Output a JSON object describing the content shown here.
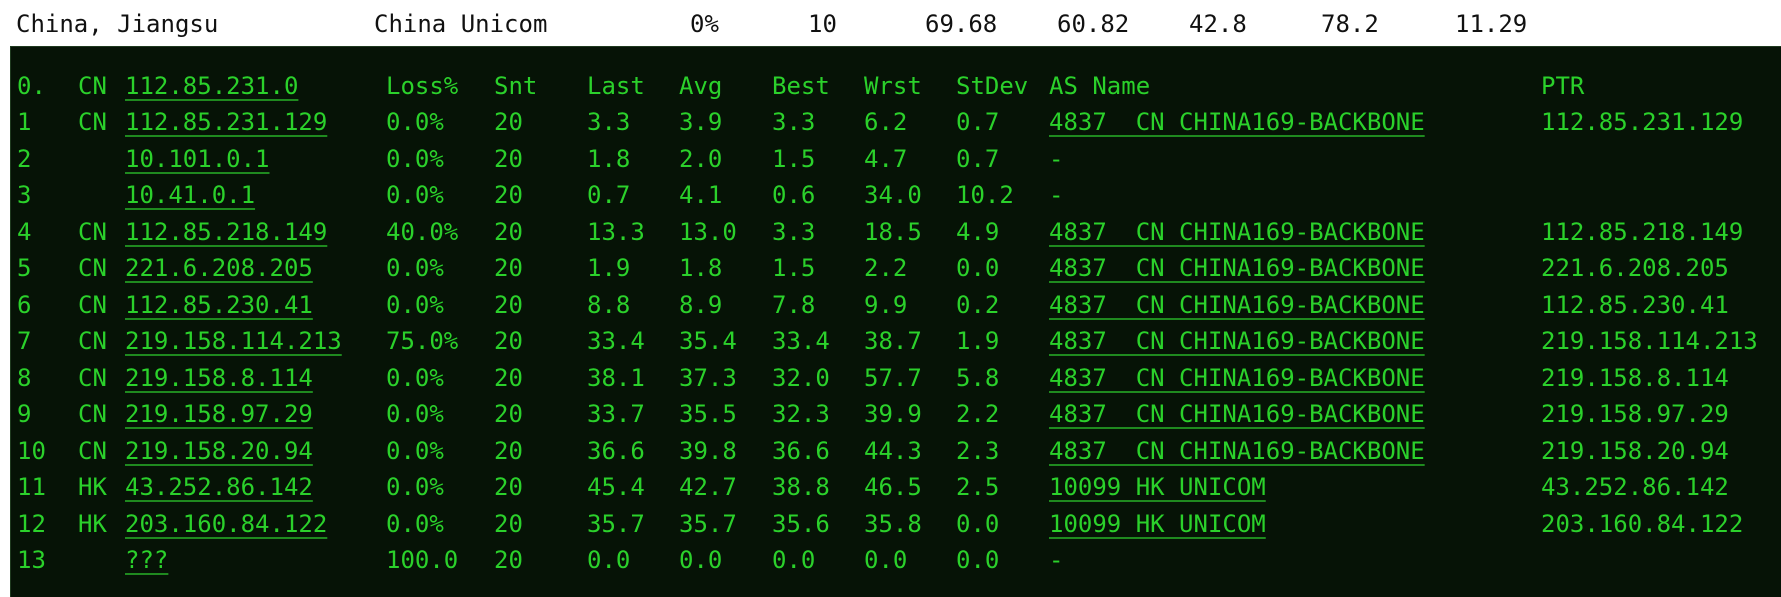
{
  "summary": {
    "location": "China, Jiangsu",
    "isp": "China Unicom",
    "loss": "0%",
    "snt": "10",
    "v1": "69.68",
    "v2": "60.82",
    "v3": "42.8",
    "v4": "78.2",
    "v5": "11.29"
  },
  "header": {
    "num": "0.",
    "cc": "CN",
    "host": "112.85.231.0",
    "loss": "Loss%",
    "snt": "Snt",
    "last": "Last",
    "avg": "Avg",
    "best": "Best",
    "wrst": "Wrst",
    "stdev": "StDev",
    "asname": "AS Name",
    "ptr": "PTR"
  },
  "hops": [
    {
      "num": "1",
      "cc": "CN",
      "host": "112.85.231.129",
      "loss": "0.0%",
      "snt": "20",
      "last": "3.3",
      "avg": "3.9",
      "best": "3.3",
      "wrst": "6.2",
      "stdev": "0.7",
      "as": "4837  CN CHINA169-BACKBONE",
      "ptr": "112.85.231.129"
    },
    {
      "num": "2",
      "cc": "",
      "host": "10.101.0.1",
      "loss": "0.0%",
      "snt": "20",
      "last": "1.8",
      "avg": "2.0",
      "best": "1.5",
      "wrst": "4.7",
      "stdev": "0.7",
      "as": "-",
      "ptr": ""
    },
    {
      "num": "3",
      "cc": "",
      "host": "10.41.0.1",
      "loss": "0.0%",
      "snt": "20",
      "last": "0.7",
      "avg": "4.1",
      "best": "0.6",
      "wrst": "34.0",
      "stdev": "10.2",
      "as": "-",
      "ptr": ""
    },
    {
      "num": "4",
      "cc": "CN",
      "host": "112.85.218.149",
      "loss": "40.0%",
      "snt": "20",
      "last": "13.3",
      "avg": "13.0",
      "best": "3.3",
      "wrst": "18.5",
      "stdev": "4.9",
      "as": "4837  CN CHINA169-BACKBONE",
      "ptr": "112.85.218.149"
    },
    {
      "num": "5",
      "cc": "CN",
      "host": "221.6.208.205",
      "loss": "0.0%",
      "snt": "20",
      "last": "1.9",
      "avg": "1.8",
      "best": "1.5",
      "wrst": "2.2",
      "stdev": "0.0",
      "as": "4837  CN CHINA169-BACKBONE",
      "ptr": "221.6.208.205"
    },
    {
      "num": "6",
      "cc": "CN",
      "host": "112.85.230.41",
      "loss": "0.0%",
      "snt": "20",
      "last": "8.8",
      "avg": "8.9",
      "best": "7.8",
      "wrst": "9.9",
      "stdev": "0.2",
      "as": "4837  CN CHINA169-BACKBONE",
      "ptr": "112.85.230.41"
    },
    {
      "num": "7",
      "cc": "CN",
      "host": "219.158.114.213",
      "loss": "75.0%",
      "snt": "20",
      "last": "33.4",
      "avg": "35.4",
      "best": "33.4",
      "wrst": "38.7",
      "stdev": "1.9",
      "as": "4837  CN CHINA169-BACKBONE",
      "ptr": "219.158.114.213"
    },
    {
      "num": "8",
      "cc": "CN",
      "host": "219.158.8.114",
      "loss": "0.0%",
      "snt": "20",
      "last": "38.1",
      "avg": "37.3",
      "best": "32.0",
      "wrst": "57.7",
      "stdev": "5.8",
      "as": "4837  CN CHINA169-BACKBONE",
      "ptr": "219.158.8.114"
    },
    {
      "num": "9",
      "cc": "CN",
      "host": "219.158.97.29",
      "loss": "0.0%",
      "snt": "20",
      "last": "33.7",
      "avg": "35.5",
      "best": "32.3",
      "wrst": "39.9",
      "stdev": "2.2",
      "as": "4837  CN CHINA169-BACKBONE",
      "ptr": "219.158.97.29"
    },
    {
      "num": "10",
      "cc": "CN",
      "host": "219.158.20.94",
      "loss": "0.0%",
      "snt": "20",
      "last": "36.6",
      "avg": "39.8",
      "best": "36.6",
      "wrst": "44.3",
      "stdev": "2.3",
      "as": "4837  CN CHINA169-BACKBONE",
      "ptr": "219.158.20.94"
    },
    {
      "num": "11",
      "cc": "HK",
      "host": "43.252.86.142",
      "loss": "0.0%",
      "snt": "20",
      "last": "45.4",
      "avg": "42.7",
      "best": "38.8",
      "wrst": "46.5",
      "stdev": "2.5",
      "as": "10099 HK UNICOM",
      "ptr": "43.252.86.142"
    },
    {
      "num": "12",
      "cc": "HK",
      "host": "203.160.84.122",
      "loss": "0.0%",
      "snt": "20",
      "last": "35.7",
      "avg": "35.7",
      "best": "35.6",
      "wrst": "35.8",
      "stdev": "0.0",
      "as": "10099 HK UNICOM",
      "ptr": "203.160.84.122"
    },
    {
      "num": "13",
      "cc": "",
      "host": "???",
      "loss": "100.0",
      "snt": "20",
      "last": "0.0",
      "avg": "0.0",
      "best": "0.0",
      "wrst": "0.0",
      "stdev": "0.0",
      "as": "-",
      "ptr": ""
    }
  ],
  "colors": {
    "terminal_bg": "#061306",
    "terminal_fg": "#2bd12b",
    "link_underline": "#1f8a1f"
  }
}
